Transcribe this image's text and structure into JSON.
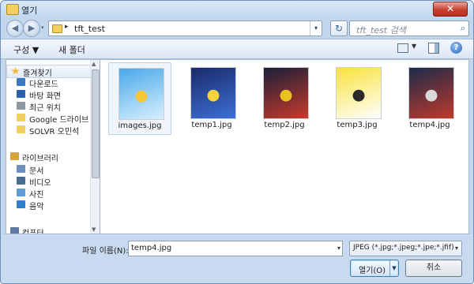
{
  "window": {
    "title": "열기",
    "close_glyph": "✕"
  },
  "nav": {
    "back_glyph": "◀",
    "forward_glyph": "▶",
    "history_glyph": "▾",
    "address": {
      "separator": "▸",
      "path": "tft_test",
      "dropdown_glyph": "▾"
    },
    "refresh_glyph": "↻",
    "search": {
      "placeholder": "tft_test 검색",
      "icon_glyph": "⌕"
    }
  },
  "toolbar": {
    "organize_label": "구성 ▼",
    "new_folder_label": "새 폴더",
    "view_dropdown_glyph": "▼",
    "help_glyph": "?"
  },
  "sidebar": {
    "favorites": {
      "label": "즐겨찾기",
      "icon": "star-icon",
      "color": "#f0b43a"
    },
    "favorite_items": [
      {
        "label": "다운로드",
        "icon": "downloads-folder-icon",
        "color": "#3b79c4"
      },
      {
        "label": "바탕 화면",
        "icon": "desktop-icon",
        "color": "#2b5fb0"
      },
      {
        "label": "최근 위치",
        "icon": "recent-places-icon",
        "color": "#8d97a3"
      },
      {
        "label": "Google 드라이브",
        "icon": "google-drive-folder-icon",
        "color": "#f1cf5e"
      },
      {
        "label": "SOLVR 오민석",
        "icon": "folder-icon",
        "color": "#f1cf5e"
      }
    ],
    "libraries": {
      "label": "라이브러리",
      "icon": "library-icon",
      "color": "#d7a33c"
    },
    "library_items": [
      {
        "label": "문서",
        "icon": "documents-icon",
        "color": "#6b8fbf"
      },
      {
        "label": "비디오",
        "icon": "videos-icon",
        "color": "#4a6a8f"
      },
      {
        "label": "사진",
        "icon": "pictures-icon",
        "color": "#5d9cd6"
      },
      {
        "label": "음악",
        "icon": "music-icon",
        "color": "#2f7fcf"
      }
    ],
    "computer": {
      "label": "컴퓨터",
      "icon": "computer-icon",
      "color": "#5b79a3"
    },
    "scroll_up_glyph": "▲",
    "scroll_down_glyph": "▼"
  },
  "files": [
    {
      "name": "images.jpg",
      "thumb": "images-thumb",
      "colors": [
        "#4aa8e8",
        "#d6f0ff",
        "#f7c638"
      ]
    },
    {
      "name": "temp1.jpg",
      "thumb": "sonic-cover-thumb",
      "colors": [
        "#1a2b6b",
        "#3d6fd4",
        "#f6d33a"
      ]
    },
    {
      "name": "temp2.jpg",
      "thumb": "angry-birds-space-thumb",
      "colors": [
        "#1b1f3a",
        "#c83a2a",
        "#e9c21d"
      ]
    },
    {
      "name": "temp3.jpg",
      "thumb": "spongebob-thumb",
      "colors": [
        "#f8e23a",
        "#ffffff",
        "#2a2a2a"
      ]
    },
    {
      "name": "temp4.jpg",
      "thumb": "captain-america-thumb",
      "colors": [
        "#1d2b4a",
        "#c0392b",
        "#d9d9d9"
      ]
    }
  ],
  "bottom": {
    "filename_label": "파일 이름(N):",
    "filename_value": "temp4.jpg",
    "filename_dropdown_glyph": "▾",
    "filetype_value": "JPEG (*.jpg;*.jpeg;*.jpe;*.jfif)",
    "filetype_dropdown_glyph": "▾",
    "open_label": "열기(O)",
    "open_split_glyph": "▼",
    "cancel_label": "취소"
  }
}
